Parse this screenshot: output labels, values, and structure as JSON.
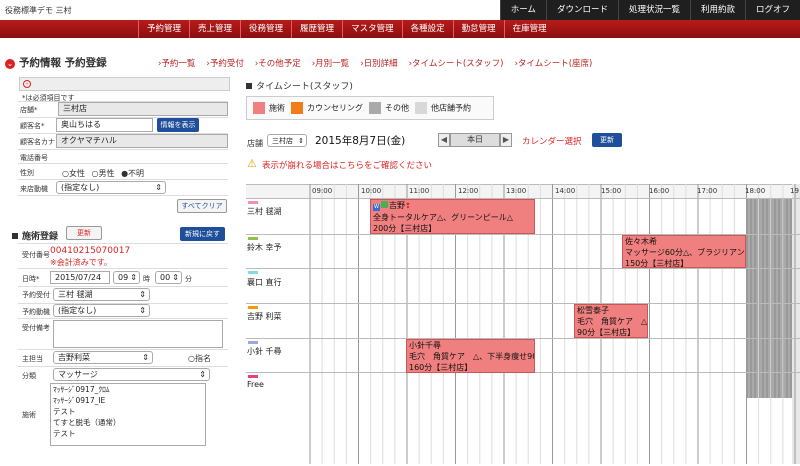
{
  "app_title": "役務標準デモ 三村",
  "top_nav": [
    "ホーム",
    "ダウンロード",
    "処理状況一覧",
    "利用約款",
    "ログオフ"
  ],
  "red_nav": [
    "予約管理",
    "売上管理",
    "役務管理",
    "履歴管理",
    "マスタ管理",
    "各種設定",
    "勤怠管理",
    "在庫管理"
  ],
  "page_title": "予約情報 予約登録",
  "sub_links": [
    "予約一覧",
    "予約受付",
    "その他予定",
    "月別一覧",
    "日別詳細",
    "タイムシート(スタッフ)",
    "タイムシート(座席)"
  ],
  "form": {
    "required_note": "*は必須項目です",
    "store_label": "店舗*",
    "store_value": "三村店",
    "customer_label": "顧客名*",
    "customer_value": "奥山ちはる",
    "info_btn": "情報を表示",
    "kana_label": "顧客名カナ",
    "kana_value": "オクヤマチハル",
    "phone_label": "電話番号",
    "gender_label": "性別",
    "gender_options": [
      "女性",
      "男性",
      "不明"
    ],
    "visit_label": "来店動機",
    "visit_value": "(指定なし)",
    "clear_btn": "すべてクリア",
    "section": "施術登録",
    "update_btn": "更新",
    "back_btn": "新規に戻す",
    "receipt_label": "受付番号",
    "receipt_no": "00410215070017",
    "receipt_note": "※会計済みです。",
    "datetime_label": "日時*",
    "date_value": "2015/07/24",
    "hour": "09",
    "hour_unit": "時",
    "minute": "00",
    "minute_unit": "分",
    "reception_label": "予約受付",
    "reception_value": "三村 毬湖",
    "motive_label": "予約動機",
    "motive_value": "(指定なし)",
    "remarks_label": "受付備考",
    "staff_label": "主担当",
    "staff_value": "吉野利菜",
    "nominate_label": "指名",
    "category_label": "分類",
    "category_value": "マッサージ",
    "treatment_label": "施術",
    "treatments": [
      "ﾏｯｻｰｼﾞ0917_ｸﾛﾑ",
      "ﾏｯｻｰｼﾞ0917_IE",
      "テスト",
      "てすと脱毛（通常）",
      "テスト"
    ]
  },
  "timesheet": {
    "title": "タイムシート(スタッフ)",
    "legend": [
      {
        "label": "施術",
        "color": "#f08080"
      },
      {
        "label": "カウンセリング",
        "color": "#f07d1a"
      },
      {
        "label": "その他",
        "color": "#aaaaaa"
      },
      {
        "label": "他店舗予約",
        "color": "#d8d8d8"
      }
    ],
    "store_label": "店舗",
    "store_value": "三村店",
    "date": "2015年8月7日(金)",
    "today_btn": "本日",
    "calendar_link": "カレンダー選択",
    "refresh_btn": "更新",
    "warning": "表示が崩れる場合はこちらをご確認ください",
    "hours": [
      "09:00",
      "10:00",
      "11:00",
      "12:00",
      "13:00",
      "14:00",
      "15:00",
      "16:00",
      "17:00",
      "18:00",
      "19"
    ],
    "staff": [
      {
        "name": "三村 毬湖",
        "color": "#f48fb1"
      },
      {
        "name": "鈴木 幸予",
        "color": "#8bc34a"
      },
      {
        "name": "襄口 直行",
        "color": "#80deea"
      },
      {
        "name": "吉野 利菜",
        "color": "#ff9800"
      },
      {
        "name": "小針 千尋",
        "color": "#9fa8da"
      },
      {
        "name": "Free",
        "color": "#ec407a"
      }
    ],
    "appointments": [
      {
        "lines": [
          "吉野",
          "全身トータルケア△、グリーンピール△",
          "200分【三村店】"
        ]
      },
      {
        "lines": [
          "佐々木希",
          "マッサージ60分△、ブラジリアン",
          "150分【三村店】"
        ]
      },
      {
        "lines": [
          "松雪泰子",
          "毛穴　角質ケア　△",
          "90分【三村店】"
        ]
      },
      {
        "lines": [
          "小針千尋",
          "毛穴　角質ケア　△、下半身痩せ90",
          "160分【三村店】"
        ]
      }
    ]
  }
}
